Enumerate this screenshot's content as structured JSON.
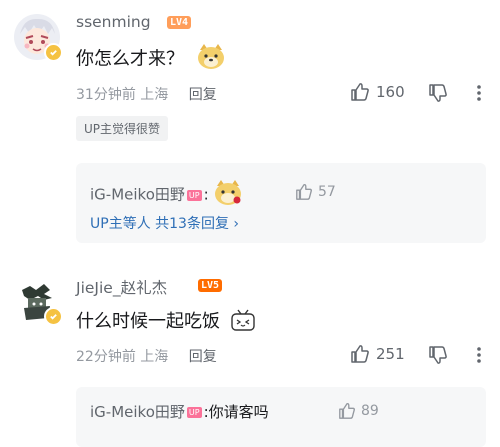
{
  "comments": [
    {
      "username": "ssenming",
      "level": "LV4",
      "level_color": "#ff9e5a",
      "text": "你怎么才来？",
      "emoji_icon": "doge-emoji-icon",
      "time": "31分钟前",
      "location": "上海",
      "reply_label": "回复",
      "likes": "160",
      "tag": "UP主觉得很赞",
      "sub_reply": {
        "author": "iG-Meiko田野",
        "up_badge": "UP",
        "separator": ":",
        "text": "",
        "emoji_icon": "doge-emoji-icon",
        "likes": "57"
      },
      "more_replies": "UP主等人 共13条回复 ›"
    },
    {
      "username": "JieJie_赵礼杰",
      "level": "LV5",
      "level_color": "#ff6c00",
      "text": "什么时候一起吃饭",
      "emoji_icon": "tv-smile-emoji-icon",
      "time": "22分钟前",
      "location": "上海",
      "reply_label": "回复",
      "likes": "251",
      "sub_reply": {
        "author": "iG-Meiko田野",
        "up_badge": "UP",
        "separator": ":",
        "text": "你请客吗",
        "likes": "89"
      }
    }
  ]
}
